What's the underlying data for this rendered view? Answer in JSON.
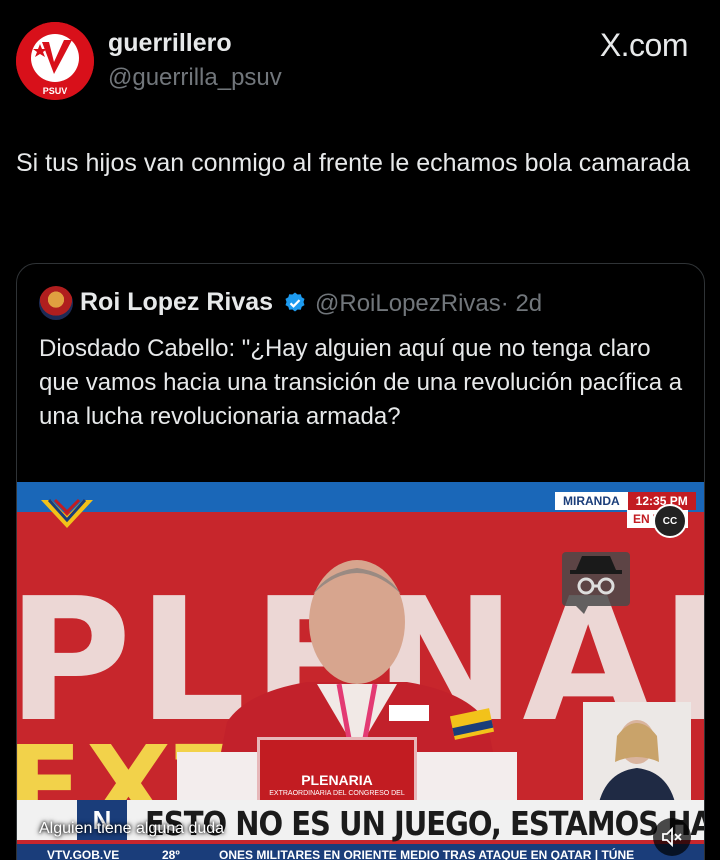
{
  "post": {
    "display_name": "guerrillero",
    "handle": "@guerrilla_psuv",
    "brand": "X.com",
    "text": "Si tus hijos van conmigo al frente le echamos bola camarada",
    "avatar_text": "PSUV"
  },
  "quoted": {
    "display_name": "Roi Lopez Rivas",
    "handle": "@RoiLopezRivas",
    "time": "· 2d",
    "text": "Diosdado Cabello: \"¿Hay alguien aquí que no tenga claro que vamos hacia una transición de una revolución pacífica a una lucha revolucionaria armada?",
    "verified_icon": "verified-badge-icon"
  },
  "video": {
    "bg_word": "PLENAR",
    "bg_word2": "EXT",
    "location": "MIRANDA",
    "time": "12:35 PM",
    "live": "EN VIVO",
    "cc_label": "CC",
    "podium_title": "PLENARIA",
    "podium_subtitle": "EXTRAORDINARIA DEL CONGRESO DEL",
    "ticker_tag": "N",
    "headline": "ESTO NO ES UN JUEGO, ESTAMOS HABLANDO SERIO",
    "caption": "Alguien tiene alguna duda",
    "site": "VTV.GOB.VE",
    "temp": "28º",
    "news": "ONES MILITARES EN ORIENTE MEDIO TRAS ATAQUE EN QATAR  |  TÚNE"
  },
  "colors": {
    "background": "#000000",
    "text": "#e7e9ea",
    "muted": "#71767b",
    "verified": "#1d9bf0",
    "psuv_red": "#d8101a"
  }
}
